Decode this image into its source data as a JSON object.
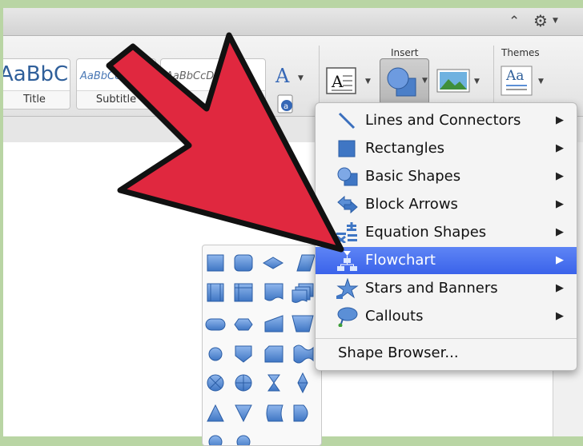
{
  "ribbon": {
    "styles": [
      {
        "sample": "AaBbC",
        "label": "Title"
      },
      {
        "sample": "AaBbCcDd",
        "label": "Subtitle"
      },
      {
        "sample": "AaBbCcDd",
        "label": ""
      }
    ],
    "insert_label": "Insert",
    "themes_label": "Themes",
    "themes_button_sample": "Aa"
  },
  "menu": {
    "items": [
      {
        "label": "Lines and Connectors",
        "icon": "line-icon",
        "submenu": true
      },
      {
        "label": "Rectangles",
        "icon": "rectangle-icon",
        "submenu": true
      },
      {
        "label": "Basic Shapes",
        "icon": "basic-shapes-icon",
        "submenu": true
      },
      {
        "label": "Block Arrows",
        "icon": "block-arrows-icon",
        "submenu": true
      },
      {
        "label": "Equation Shapes",
        "icon": "equation-icon",
        "submenu": true
      },
      {
        "label": "Flowchart",
        "icon": "flowchart-icon",
        "submenu": true,
        "highlighted": true
      },
      {
        "label": "Stars and Banners",
        "icon": "star-icon",
        "submenu": true
      },
      {
        "label": "Callouts",
        "icon": "callout-icon",
        "submenu": true
      }
    ],
    "shape_browser": "Shape Browser...",
    "submenu_arrow": "▶",
    "highlight_color": "#3f68ec"
  },
  "gallery": {
    "shapes": [
      "process-shape",
      "alternate-process-shape",
      "decision-shape",
      "data-shape",
      "predefined-process-shape",
      "internal-storage-shape",
      "document-shape",
      "multidocument-shape",
      "terminator-shape",
      "preparation-shape",
      "manual-input-shape",
      "manual-operation-shape",
      "connector-shape",
      "offpage-connector-shape",
      "card-shape",
      "punched-tape-shape",
      "summing-junction-shape",
      "or-shape",
      "collate-shape",
      "sort-shape",
      "extract-shape",
      "merge-shape",
      "stored-data-shape",
      "delay-shape"
    ]
  },
  "colors": {
    "shape_blue": "#5b8fd6",
    "red_arrow": "#e0283f"
  }
}
